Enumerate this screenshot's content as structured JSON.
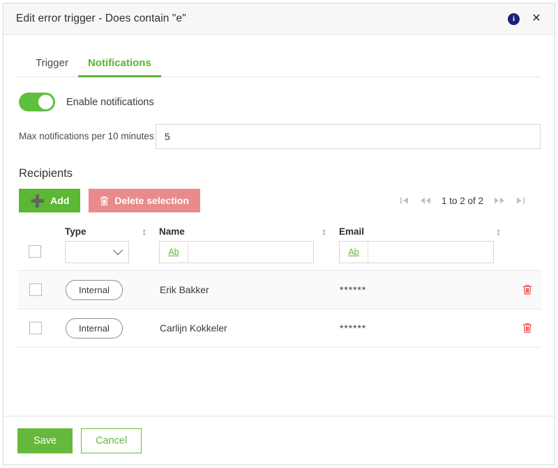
{
  "dialog": {
    "title": "Edit error trigger - Does contain \"e\"",
    "info_icon": "info-icon",
    "close_icon": "close-icon"
  },
  "tabs": [
    {
      "label": "Trigger",
      "active": false
    },
    {
      "label": "Notifications",
      "active": true
    }
  ],
  "notifications": {
    "toggle_label": "Enable notifications",
    "toggle_on": true,
    "max_label": "Max notifications per 10 minutes",
    "max_value": "5",
    "max_placeholder": ""
  },
  "recipients": {
    "section_title": "Recipients",
    "add_label": "Add",
    "add_icon": "plus-icon",
    "delete_label": "Delete selection",
    "delete_icon": "trash-icon",
    "pager": {
      "first_icon": "first-page-icon",
      "prev_icon": "previous-page-icon",
      "text": "1 to 2 of 2",
      "next_icon": "next-page-icon",
      "last_icon": "last-page-icon"
    },
    "columns": [
      {
        "key": "type",
        "label": "Type",
        "sort_icon": "sort-icon"
      },
      {
        "key": "name",
        "label": "Name",
        "sort_icon": "sort-icon"
      },
      {
        "key": "email",
        "label": "Email",
        "sort_icon": "sort-icon"
      }
    ],
    "filters": {
      "type_value": "",
      "type_chevron": "chevron-down-icon",
      "name_prefix": "Ab",
      "name_value": "",
      "email_prefix": "Ab",
      "email_value": ""
    },
    "rows": [
      {
        "checked": false,
        "type": "Internal",
        "name": "Erik Bakker",
        "email": "******",
        "delete_icon": "trash-icon"
      },
      {
        "checked": false,
        "type": "Internal",
        "name": "Carlijn Kokkeler",
        "email": "******",
        "delete_icon": "trash-icon"
      }
    ]
  },
  "footer": {
    "save_label": "Save",
    "cancel_label": "Cancel"
  },
  "colors": {
    "accent_green": "#5cb735",
    "delete_salmon": "#e98a8c",
    "info_navy": "#1c1f7a",
    "trash_red": "#f05252"
  }
}
